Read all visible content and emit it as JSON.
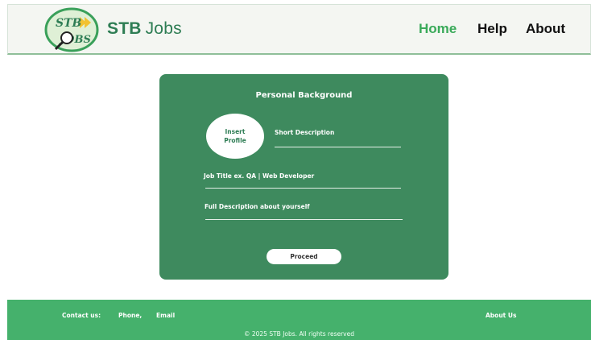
{
  "header": {
    "brand_strong": "STB",
    "brand_light": "Jobs",
    "logo_text_top": "STB",
    "logo_text_bottom": "JOBS",
    "nav": {
      "home": "Home",
      "help": "Help",
      "about": "About"
    }
  },
  "form": {
    "title": "Personal Background",
    "profile_line1": "Insert",
    "profile_line2": "Profile",
    "short_description_placeholder": "Short Description",
    "job_title_placeholder": "Job Title ex. QA | Web Developer",
    "full_description_placeholder": "Full Description about yourself",
    "proceed_label": "Proceed"
  },
  "footer": {
    "contact_label": "Contact us:",
    "phone": "Phone,",
    "email": "Email",
    "about_us": "About Us",
    "copyright": "© 2025 STB Jobs. All rights reserved"
  },
  "colors": {
    "brand_green": "#2e7d54",
    "nav_active": "#3aaa5a",
    "card_bg": "#3e8a5e",
    "footer_bg": "#45b16c"
  }
}
